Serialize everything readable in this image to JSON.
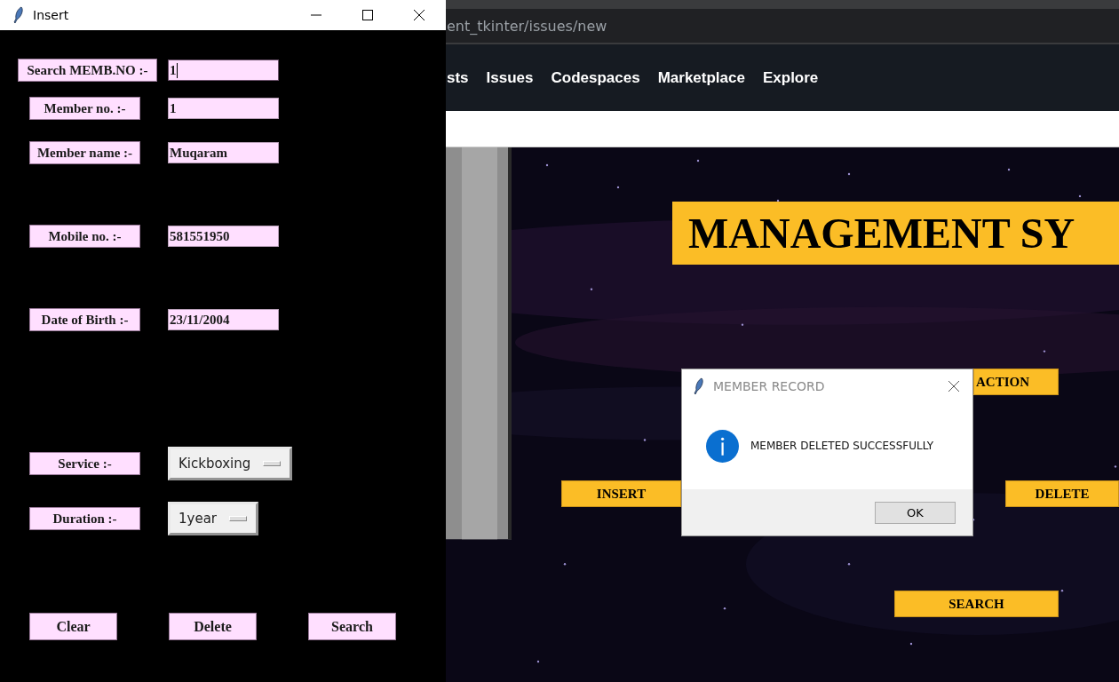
{
  "browser": {
    "address": "ent_tkinter/issues/new",
    "nav": [
      "sts",
      "Issues",
      "Codespaces",
      "Marketplace",
      "Explore"
    ]
  },
  "app": {
    "banner": "MANAGEMENT SY",
    "buttons": [
      {
        "label": "ACTION"
      },
      {
        "label": "INSERT"
      },
      {
        "label": "DELETE"
      },
      {
        "label": "SEARCH"
      }
    ]
  },
  "insert_window": {
    "title": "Insert",
    "fields": [
      {
        "label": "Search MEMB.NO :-",
        "kind": "entry",
        "value": "1",
        "focused": true
      },
      {
        "label": "Member no. :-",
        "kind": "entry",
        "value": "1",
        "focused": false
      },
      {
        "label": "Member name :-",
        "kind": "entry",
        "value": "Muqaram",
        "focused": false
      },
      {
        "label": "Mobile no. :-",
        "kind": "entry",
        "value": "581551950",
        "focused": false
      },
      {
        "label": "Date of Birth :-",
        "kind": "entry",
        "value": "23/11/2004",
        "focused": false
      },
      {
        "label": "Service :-",
        "kind": "menu",
        "value": "Kickboxing"
      },
      {
        "label": "Duration :-",
        "kind": "menu",
        "value": "1year"
      }
    ],
    "buttons": [
      "Clear",
      "Delete",
      "Search"
    ]
  },
  "dialog": {
    "title": "MEMBER RECORD",
    "message": "MEMBER DELETED SUCCESSFULLY",
    "buttons": [
      "OK"
    ]
  }
}
